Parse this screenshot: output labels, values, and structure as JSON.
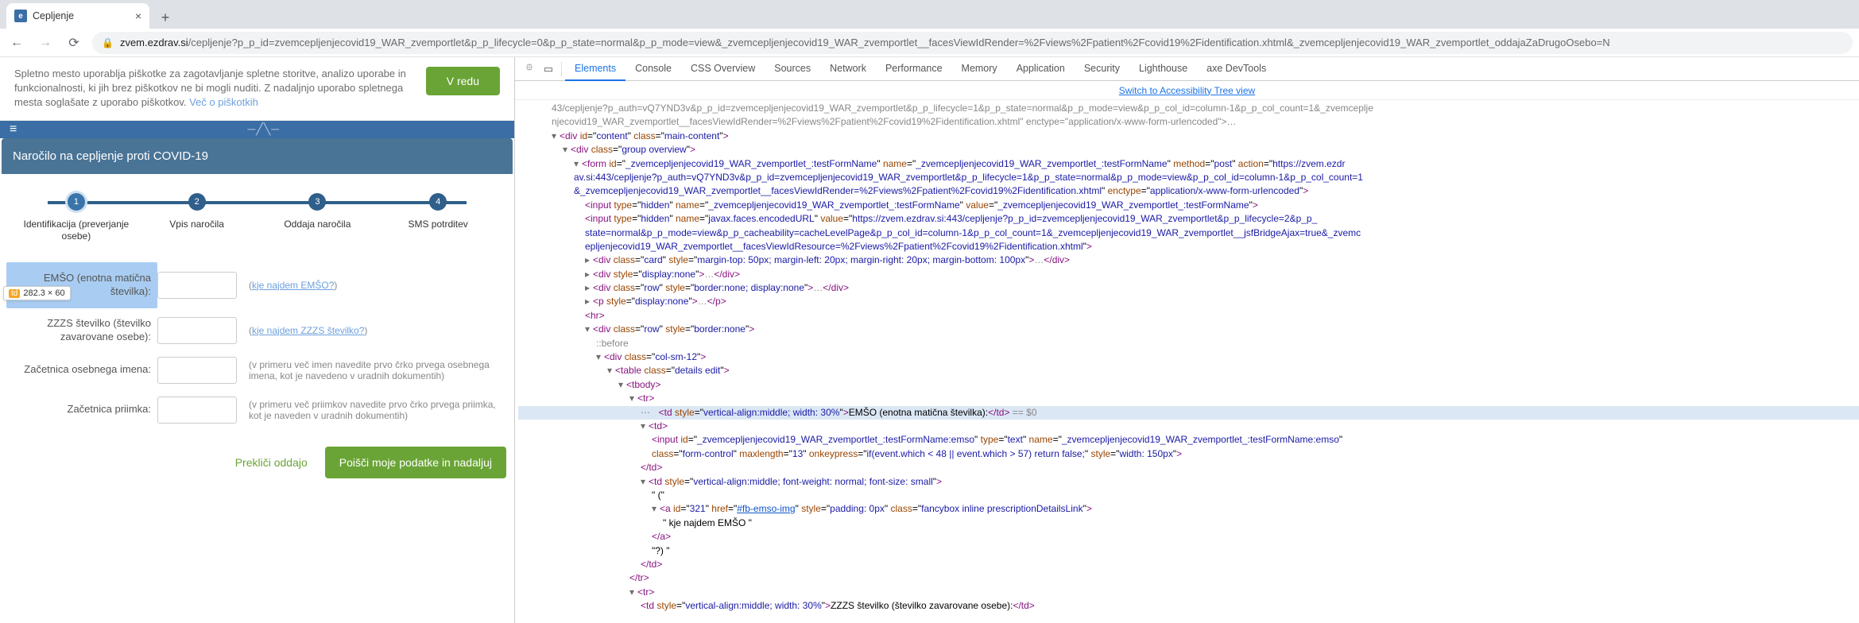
{
  "browser": {
    "tab_title": "Cepljenje",
    "new_tab_tooltip": "+",
    "nav": {
      "back": "←",
      "forward": "→",
      "reload": "⟳"
    },
    "url_host": "zvem.ezdrav.si",
    "url_path": "/cepljenje?p_p_id=zvemcepljenjecovid19_WAR_zvemportlet&p_p_lifecycle=0&p_p_state=normal&p_p_mode=view&_zvemcepljenjecovid19_WAR_zvemportlet__facesViewIdRender=%2Fviews%2Fpatient%2Fcovid19%2Fidentification.xhtml&_zvemcepljenjecovid19_WAR_zvemportlet_oddajaZaDrugoOsebo=N"
  },
  "cookie": {
    "text1": "Spletno mesto uporablja piškotke za zagotavljanje spletne storitve, analizo uporabe in funkcionalnosti, ki jih brez piškotkov ne bi mogli nuditi. Z nadaljnjo uporabo spletnega mesta soglašate z uporabo piškotkov. ",
    "link": "Več o piškotkih",
    "btn": "V redu"
  },
  "page": {
    "title": "Naročilo na cepljenje proti COVID-19",
    "steps": [
      {
        "num": "1",
        "label": "Identifikacija (preverjanje osebe)"
      },
      {
        "num": "2",
        "label": "Vpis naročila"
      },
      {
        "num": "3",
        "label": "Oddaja naročila"
      },
      {
        "num": "4",
        "label": "SMS potrditev"
      }
    ],
    "tooltip_tag": "td",
    "tooltip_size": "282.3 × 60",
    "form": {
      "emso_label": "EMŠO (enotna matična številka):",
      "emso_help_pre": "(",
      "emso_help_link": "kje najdem EMŠO?",
      "emso_help_post": ")",
      "zzzs_label": "ZZZS številko (številko zavarovane osebe):",
      "zzzs_help_pre": "(",
      "zzzs_help_link": "kje najdem ZZZS številko?",
      "zzzs_help_post": ")",
      "ime_label": "Začetnica osebnega imena:",
      "ime_help": "(v primeru več imen navedite prvo črko prvega osebnega imena, kot je navedeno v uradnih dokumentih)",
      "priimek_label": "Začetnica priimka:",
      "priimek_help": "(v primeru več priimkov navedite prvo črko prvega priimka, kot je naveden v uradnih dokumentih)"
    },
    "cancel_btn": "Prekliči oddajo",
    "submit_btn": "Poišči moje podatke in nadaljuj"
  },
  "devtools": {
    "tabs": [
      "Elements",
      "Console",
      "CSS Overview",
      "Sources",
      "Network",
      "Performance",
      "Memory",
      "Application",
      "Security",
      "Lighthouse",
      "axe DevTools"
    ],
    "switch_link": "Switch to Accessibility Tree view",
    "lines": {
      "l0": "43/cepljenje?p_auth=vQ7YND3v&p_p_id=zvemcepljenjecovid19_WAR_zvemportlet&p_p_lifecycle=1&p_p_state=normal&p_p_mode=view&p_p_col_id=column-1&p_p_col_count=1&_zvemceplje",
      "l1": "njecovid19_WAR_zvemportlet__facesViewIdRender=%2Fviews%2Fpatient%2Fcovid19%2Fidentification.xhtml\" enctype=\"application/x-www-form-urlencoded\">…",
      "l2a": "<div id=\"content\" class=\"main-content\">",
      "l3": "<div class=\"group overview\">",
      "l4a": "<form id=\"_zvemcepljenjecovid19_WAR_zvemportlet_:testFormName\" name=\"_zvemcepljenjecovid19_WAR_zvemportlet_:testFormName\" method=\"post\" action=\"https://zvem.ezdr",
      "l4b": "av.si:443/cepljenje?p_auth=vQ7YND3v&p_p_id=zvemcepljenjecovid19_WAR_zvemportlet&p_p_lifecycle=1&p_p_state=normal&p_p_mode=view&p_p_col_id=column-1&p_p_col_count=1",
      "l4c": "&_zvemcepljenjecovid19_WAR_zvemportlet__facesViewIdRender=%2Fviews%2Fpatient%2Fcovid19%2Fidentification.xhtml\" enctype=\"application/x-www-form-urlencoded\">",
      "l5": "<input type=\"hidden\" name=\"_zvemcepljenjecovid19_WAR_zvemportlet_:testFormName\" value=\"_zvemcepljenjecovid19_WAR_zvemportlet_:testFormName\">",
      "l6a": "<input type=\"hidden\" name=\"javax.faces.encodedURL\" value=\"https://zvem.ezdrav.si:443/cepljenje?p_p_id=zvemcepljenjecovid19_WAR_zvemportlet&p_p_lifecycle=2&p_p_",
      "l6b": "state=normal&p_p_mode=view&p_p_cacheability=cacheLevelPage&p_p_col_id=column-1&p_p_col_count=1&_zvemcepljenjecovid19_WAR_zvemportlet__jsfBridgeAjax=true&_zvemc",
      "l6c": "epljenjecovid19_WAR_zvemportlet__facesViewIdResource=%2Fviews%2Fpatient%2Fcovid19%2Fidentification.xhtml\">",
      "l7": "<div class=\"card\" style=\"margin-top: 50px; margin-left: 20px; margin-right: 20px; margin-bottom: 100px\">…</div>",
      "l8": "<div style=\"display:none\">…</div>",
      "l9": "<div class=\"row\" style=\"border:none; display:none\">…</div>",
      "l10": "<p style=\"display:none\">…</p>",
      "l11": "<hr>",
      "l12": "<div class=\"row\" style=\"border:none\">",
      "l13": "::before",
      "l14": "<div class=\"col-sm-12\">",
      "l15": "<table class=\"details edit\">",
      "l16": "<tbody>",
      "l17": "<tr>",
      "l18a": "<td style=\"vertical-align:middle; width: 30%\">",
      "l18b": "EMŠO (enotna matična številka):",
      "l18c": "</td>",
      "l18d": " == $0",
      "l19": "<td>",
      "l20a": "<input id=\"_zvemcepljenjecovid19_WAR_zvemportlet_:testFormName:emso\" type=\"text\" name=\"_zvemcepljenjecovid19_WAR_zvemportlet_:testFormName:emso\"",
      "l20b": "class=\"form-control\" maxlength=\"13\" onkeypress=\"if(event.which < 48 || event.which > 57) return false;\" style=\"width: 150px\">",
      "l21": "</td>",
      "l22": "<td style=\"vertical-align:middle; font-weight: normal; font-size: small\">",
      "l23": "\" (\"",
      "l24": "<a id=\"321\" href=\"#fb-emso-img\" style=\"padding: 0px\" class=\"fancybox inline prescriptionDetailsLink\">",
      "l24link": "#fb-emso-img",
      "l25": "\" kje najdem EMŠO \"",
      "l26": "</a>",
      "l27": "\"?) \"",
      "l28": "</td>",
      "l29": "</tr>",
      "l30": "<tr>",
      "l31": "<td style=\"vertical-align:middle; width: 30%\">ZZZS številko (številko zavarovane osebe):</td>"
    }
  }
}
